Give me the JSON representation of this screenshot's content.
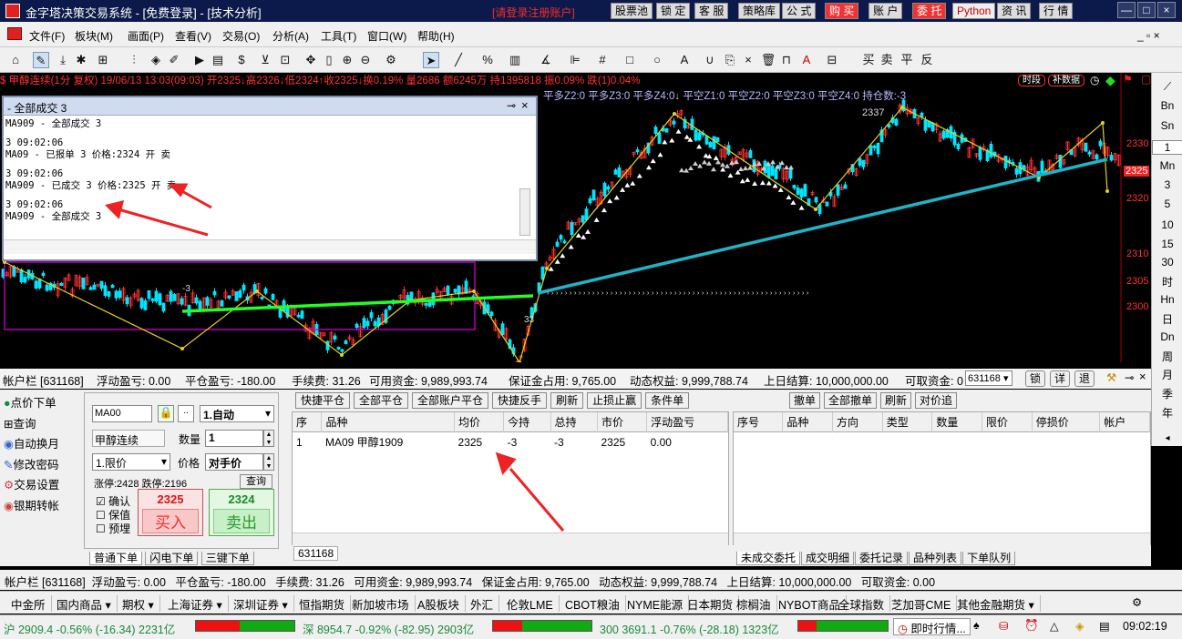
{
  "title_bar": {
    "title": "金字塔决策交易系统 - [免费登录] - [技术分析]",
    "registration_note": "[请登录注册账户]",
    "buttons": [
      "股票池",
      "锁 定",
      "客 服",
      "策略库",
      "公 式",
      "购 买",
      "账 户",
      "委 托",
      "Python",
      "资 讯",
      "行 情"
    ],
    "window_controls": [
      "—",
      "□",
      "×"
    ]
  },
  "menu": [
    "文件(F)",
    "板块(M)",
    "画面(P)",
    "查看(V)",
    "交易(O)",
    "分析(A)",
    "工具(T)",
    "窗口(W)",
    "帮助(H)"
  ],
  "toolbar": {
    "right_items": [
      "买",
      "卖",
      "平",
      "反"
    ]
  },
  "chart": {
    "info_line": "$ 甲醇连续(1分 复权) 19/06/13 13:03(09:03) 开2325↓高2326↓低2324↑收2325↓换0.19% 量2686 额6245万 持1395818 振0.09% 跌(1)0.04%",
    "indicator_line": "平多Z2:0 平多Z3:0 平多Z4:0↓ 平空Z1:0 平空Z2:0 平空Z3:0 平空Z4:0 持仓数:-3",
    "badges": [
      "时段",
      "补数据"
    ],
    "price_ticks": [
      "2330",
      "2325",
      "2320",
      "2310",
      "2305",
      "2300"
    ],
    "current_price": "2325",
    "label_peak": "2337",
    "label_33": "33",
    "label_m3": "-3"
  },
  "right_panel": [
    "Bn",
    "Sn",
    "1",
    "Mn",
    "3",
    "5",
    "10",
    "15",
    "30",
    "时",
    "Hn",
    "日",
    "Dn",
    "周",
    "月",
    "季",
    "年"
  ],
  "popup": {
    "title": "- 全部成交 3",
    "lines": [
      "MA909 - 全部成交 3",
      "3 09:02:06",
      "MA09 - 已报单 3 价格:2324 开 卖",
      "3 09:02:06",
      "MA909 - 已成交 3 价格:2325 开 卖",
      "3 09:02:06",
      "MA909 - 全部成交 3"
    ]
  },
  "account_bar": {
    "label": "帐户栏 [631168]",
    "floating_pl": "浮动盈亏: 0.00",
    "close_pl": "平仓盈亏: -180.00",
    "fee": "手续费: 31.26",
    "available": "可用资金: 9,989,993.74",
    "margin": "保证金占用: 9,765.00",
    "equity": "动态权益: 9,999,788.74",
    "settlement": "上日结算: 10,000,000.00",
    "withdrawable": "可取资金: 0",
    "account_select": "631168",
    "buttons": [
      "锁",
      "详",
      "退"
    ]
  },
  "left_nav": [
    "点价下单",
    "查询",
    "自动换月",
    "修改密码",
    "交易设置",
    "银期转帐"
  ],
  "order_form": {
    "contract": "MA00",
    "mode": "1.自动",
    "name": "甲醇连续",
    "qty_label": "数量",
    "qty": "1",
    "price_type": "1.限价",
    "price_label": "价格",
    "price": "对手价",
    "limits": "涨停:2428 跌停:2196",
    "query_btn": "查询",
    "checks": [
      "确认",
      "保值",
      "预埋"
    ],
    "buy_price": "2325",
    "buy_label": "买入",
    "sell_price": "2324",
    "sell_label": "卖出",
    "tabs": [
      "普通下单",
      "闪电下单",
      "三键下单"
    ]
  },
  "positions": {
    "buttons": [
      "快捷平仓",
      "全部平仓",
      "全部账户平仓",
      "快捷反手",
      "刷新",
      "止损止赢",
      "条件单"
    ],
    "headers": [
      "序",
      "品种",
      "均价",
      "今持",
      "总持",
      "市价",
      "浮动盈亏"
    ],
    "rows": [
      [
        "1",
        "MA09 甲醇1909",
        "2325",
        "-3",
        "-3",
        "2325",
        "0.00"
      ]
    ],
    "account_tab": "631168"
  },
  "orders": {
    "buttons": [
      "撤单",
      "全部撤单",
      "刷新",
      "对价追"
    ],
    "headers": [
      "序号",
      "品种",
      "方向",
      "类型",
      "数量",
      "限价",
      "停损价",
      "帐户"
    ],
    "tabs": [
      "未成交委托",
      "成交明细",
      "委托记录",
      "品种列表",
      "下单队列"
    ]
  },
  "account_bar2": "帐户栏 [631168]  浮动盈亏: 0.00   平仓盈亏: -180.00   手续费: 31.26   可用资金: 9,989,993.74   保证金占用: 9,765.00   动态权益: 9,999,788.74   上日结算: 10,000,000.00   可取资金: 0.00",
  "market_tabs": [
    "中金所",
    "国内商品 ▾",
    "期权 ▾",
    "上海证券 ▾",
    "深圳证券 ▾",
    "恒指期货",
    "新加坡市场",
    "A股板块",
    "外汇",
    "伦敦LME",
    "CBOT粮油",
    "NYME能源",
    "日本期货",
    "棕榈油",
    "NYBOT商品",
    "全球指数",
    "芝加哥CME",
    "其他金融期货 ▾"
  ],
  "status": {
    "sh": "沪 2909.4 -0.56% (-16.34) 2231亿",
    "sz": "深 8954.7 -0.92% (-82.95) 2903亿",
    "i300": "300 3691.1 -0.76% (-28.18) 1323亿",
    "realtime": "即时行情...",
    "time": "09:02:19"
  },
  "colors": {
    "up": "#ff3333",
    "down": "#00e5ff",
    "green_line": "#22ff22",
    "cyan_line": "#1fb3c9",
    "yellow": "#e6d11a",
    "magenta": "#d000d0"
  }
}
